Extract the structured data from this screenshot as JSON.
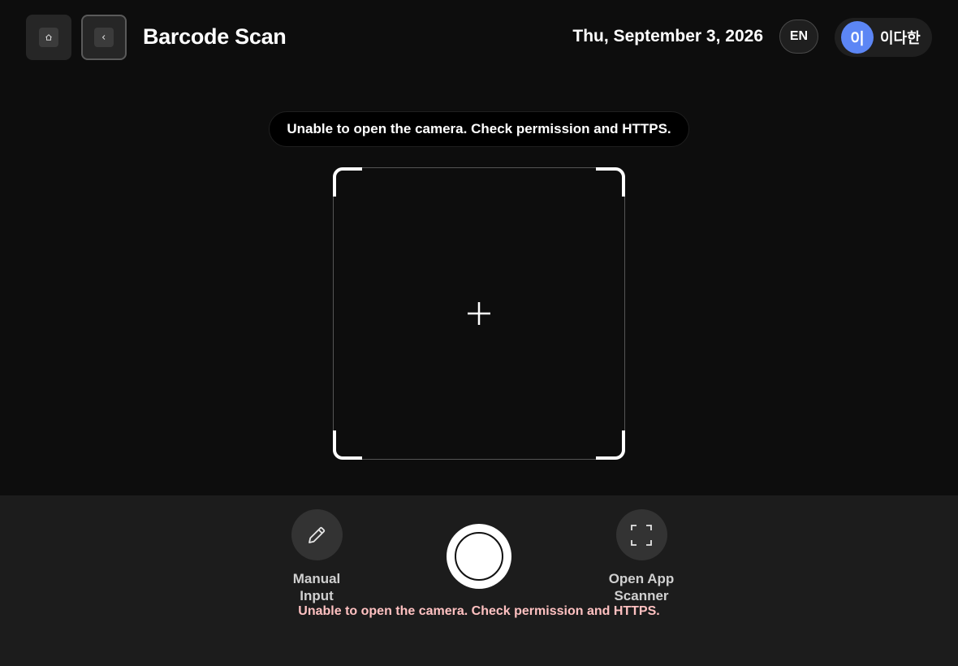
{
  "header": {
    "title": "Barcode Scan",
    "home_icon": "home-icon",
    "back_icon": "chevron-left-icon",
    "date": "Thu, September 3, 2026",
    "language": "EN",
    "user": {
      "avatar_initial": "이",
      "name": "이다한",
      "avatar_color": "#5c86f5"
    }
  },
  "camera": {
    "toast": "Unable to open the camera. Check permission and HTTPS.",
    "crosshair_icon": "plus-icon"
  },
  "controls": {
    "manual_input": {
      "label": "Manual\nInput",
      "icon": "pencil-icon"
    },
    "capture": {
      "icon": "shutter-icon"
    },
    "open_app_scanner": {
      "label": "Open App\nScanner",
      "icon": "scan-frame-icon"
    },
    "error_message": "Unable to open the camera. Check permission and HTTPS.",
    "error_color": "#ffc1c1"
  }
}
